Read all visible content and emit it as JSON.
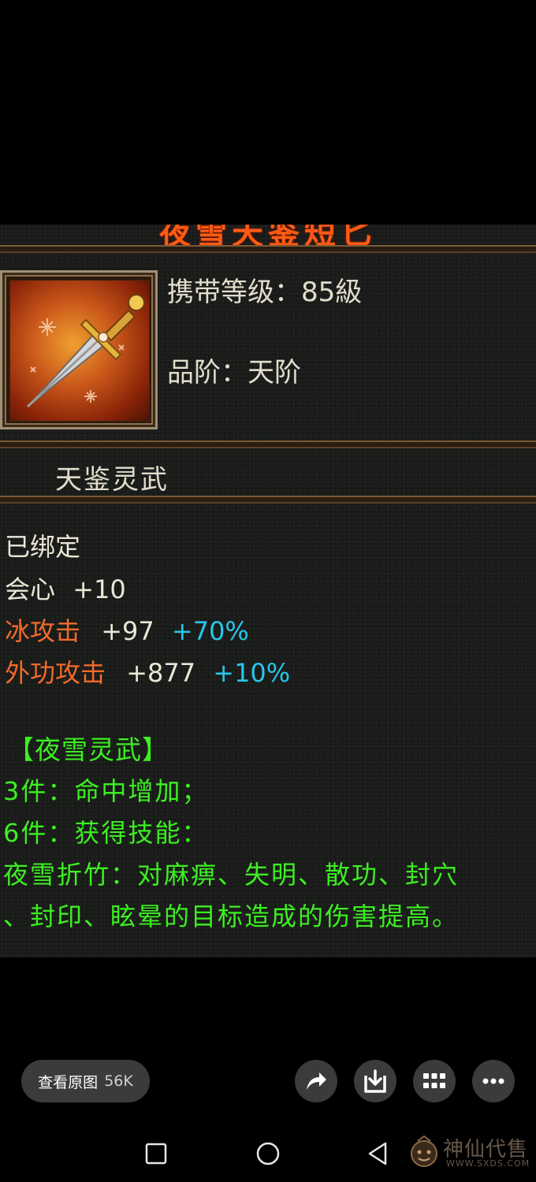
{
  "item": {
    "name": "夜雪天鉴短匕",
    "carry_level": "携带等级：85級",
    "grade": "品阶：天阶",
    "subtitle": "天鉴灵武",
    "bound": "已绑定",
    "attributes": [
      {
        "label": "会心",
        "value": "+10",
        "bonus": ""
      },
      {
        "label": "冰攻击",
        "value": "+97",
        "bonus": "+70%"
      },
      {
        "label": "外功攻击",
        "value": "+877",
        "bonus": "+10%"
      }
    ],
    "set": {
      "title": "【夜雪灵武】",
      "lines": [
        "3件：命中增加；",
        "6件：获得技能：",
        "夜雪折竹：对麻痹、失明、散功、封穴",
        "、封印、眩晕的目标造成的伤害提高。"
      ]
    },
    "icon": "snow-dagger-icon"
  },
  "toolbar": {
    "view_original_label": "查看原图",
    "view_original_size": "56K",
    "share_icon": "share-arrow-icon",
    "download_icon": "download-icon",
    "grid_icon": "grid-icon",
    "more_icon": "more-icon"
  },
  "nav": {
    "recent_icon": "square-icon",
    "home_icon": "circle-icon",
    "back_icon": "triangle-back-icon"
  },
  "watermark": {
    "text": "神仙代售",
    "url": "WWW.SXDS.COM"
  }
}
